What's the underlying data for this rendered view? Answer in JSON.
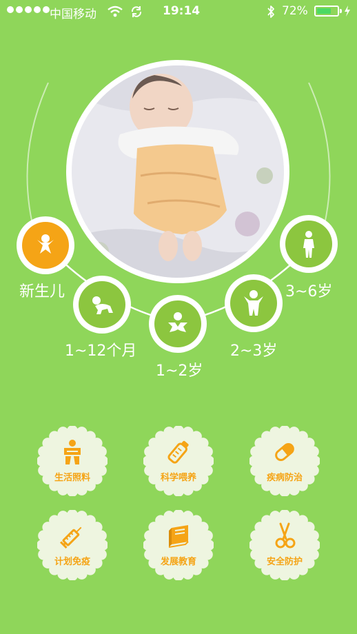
{
  "status_bar": {
    "carrier": "中国移动",
    "time": "19:14",
    "battery": "72%",
    "battery_level": 0.72
  },
  "stages": [
    {
      "label": "新生儿",
      "active": true
    },
    {
      "label": "1~12个月",
      "active": false
    },
    {
      "label": "1~2岁",
      "active": false
    },
    {
      "label": "2~3岁",
      "active": false
    },
    {
      "label": "3~6岁",
      "active": false
    }
  ],
  "categories": [
    {
      "label": "生活照料",
      "icon": "baby-care-icon"
    },
    {
      "label": "科学喂养",
      "icon": "baby-bottle-icon"
    },
    {
      "label": "疾病防治",
      "icon": "pill-capsule-icon"
    },
    {
      "label": "计划免疫",
      "icon": "syringe-icon"
    },
    {
      "label": "发展教育",
      "icon": "book-icon"
    },
    {
      "label": "安全防护",
      "icon": "scissors-icon"
    }
  ],
  "colors": {
    "background": "#8fd65a",
    "stage_green": "#8cc63f",
    "active_orange": "#f5a416",
    "badge_cream": "#eef5e0"
  }
}
